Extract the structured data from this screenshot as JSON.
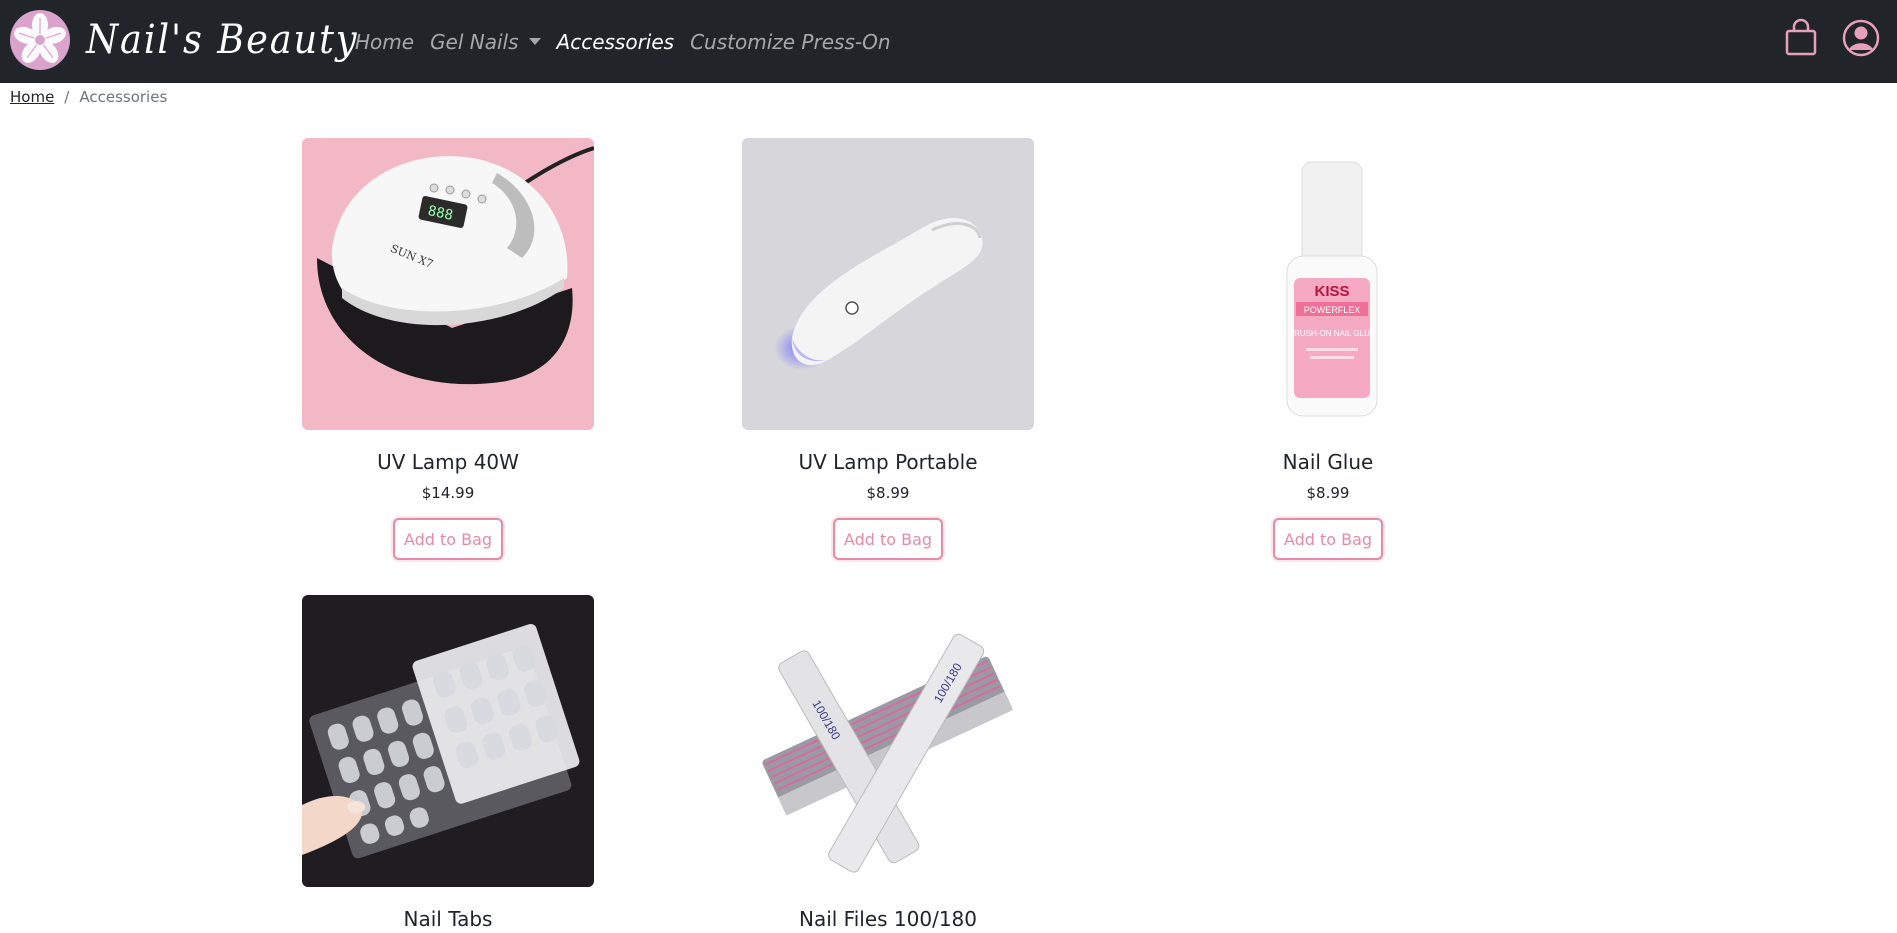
{
  "brand": {
    "name": "Nail's Beauty",
    "logo": "flower-logo-icon"
  },
  "nav": {
    "items": [
      {
        "label": "Home",
        "active": false
      },
      {
        "label": "Gel Nails",
        "active": false,
        "dropdown": true
      },
      {
        "label": "Accessories",
        "active": true
      },
      {
        "label": "Customize Press-On",
        "active": false
      }
    ],
    "icons": [
      "shopping-bag-icon",
      "user-account-icon"
    ]
  },
  "breadcrumb": {
    "home": "Home",
    "separator": "/",
    "current": "Accessories"
  },
  "products": [
    {
      "name": "UV Lamp 40W",
      "price": "$14.99",
      "button": "Add to Bag",
      "image": "uv-lamp-image"
    },
    {
      "name": "UV Lamp Portable",
      "price": "$8.99",
      "button": "Add to Bag",
      "image": "portable-uv-lamp-image"
    },
    {
      "name": "Nail Glue",
      "price": "$8.99",
      "button": "Add to Bag",
      "image": "nail-glue-image"
    },
    {
      "name": "Nail Tabs",
      "image": "nail-tabs-image"
    },
    {
      "name": "Nail Files 100/180",
      "image": "nail-files-image"
    }
  ],
  "image_text": {
    "lamp_model": "SUN X7",
    "glue_brand": "KISS",
    "glue_line": "POWERFLEX",
    "glue_label": "BRUSH-ON NAIL GLUE",
    "file_grit": "100/180"
  },
  "colors": {
    "navbar": "#212529",
    "accent": "#e88aa6",
    "logo": "#d9a3cc"
  }
}
